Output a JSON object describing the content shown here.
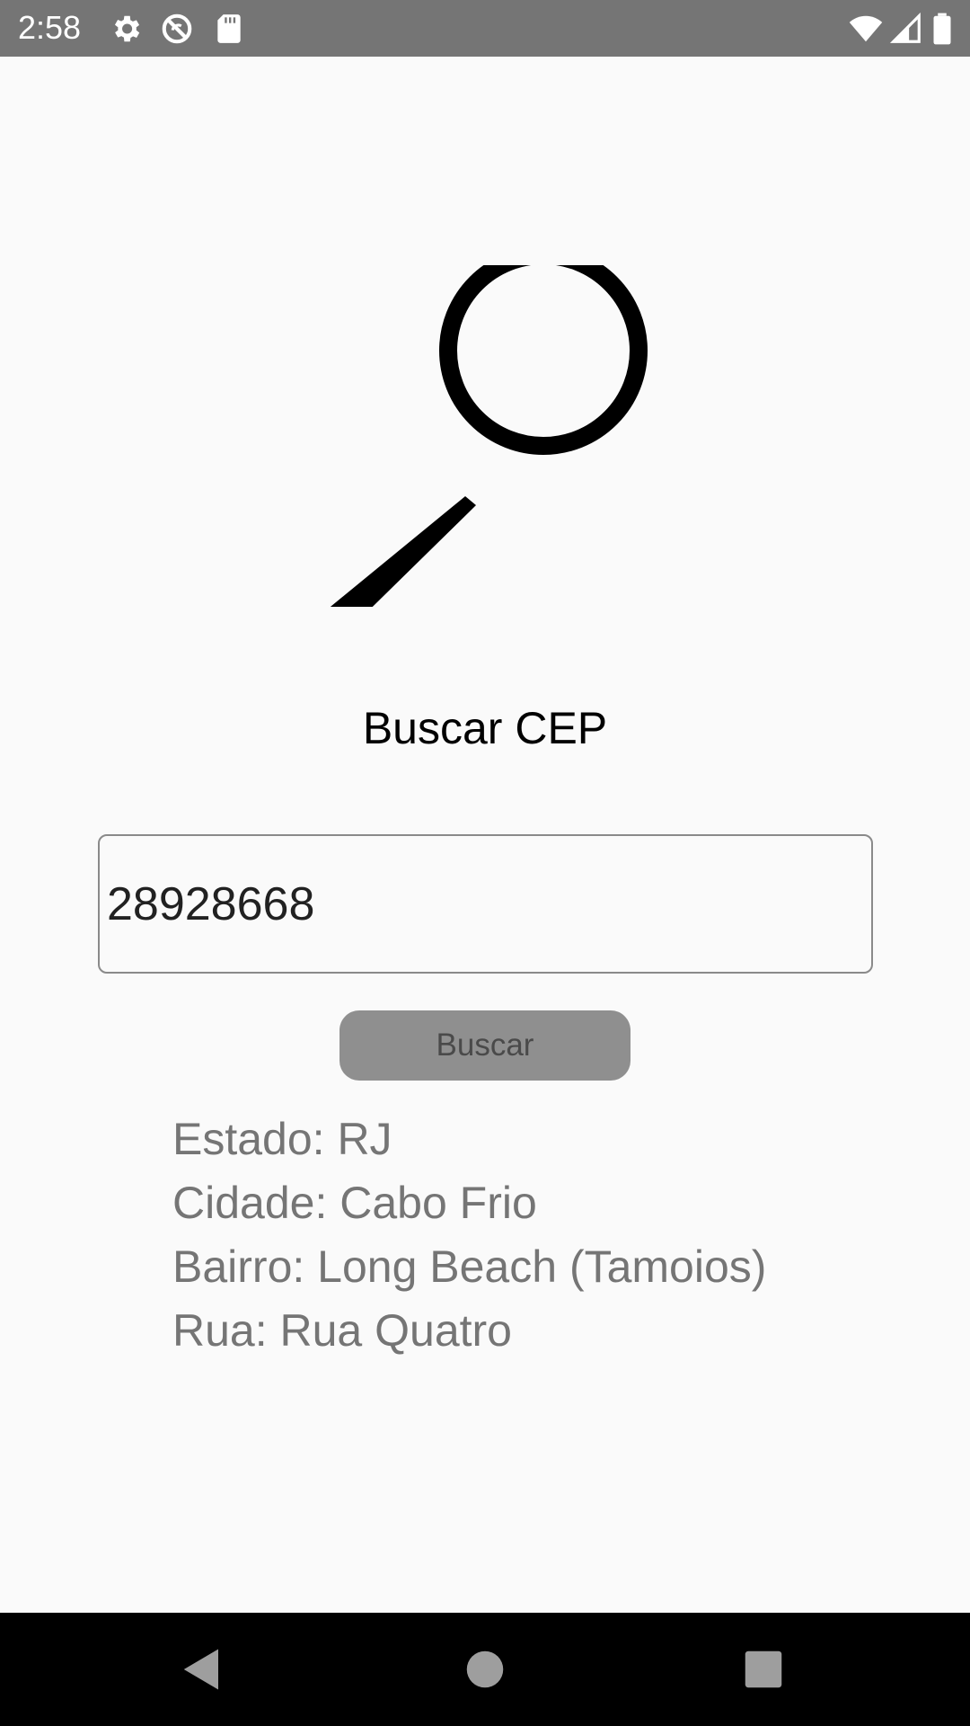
{
  "status_bar": {
    "time": "2:58",
    "left_icons": [
      "gear-icon",
      "no-sync-icon",
      "sd-card-icon"
    ],
    "right_icons": [
      "wifi-icon",
      "signal-icon",
      "battery-icon"
    ]
  },
  "main": {
    "hero_icon": "magnifying-glass-icon",
    "title": "Buscar CEP",
    "cep_input_value": "28928668",
    "search_button_label": "Buscar",
    "results": {
      "estado": "Estado: RJ",
      "cidade": "Cidade: Cabo Frio",
      "bairro": "Bairro: Long Beach (Tamoios)",
      "rua": "Rua: Rua Quatro"
    }
  },
  "nav_bar": {
    "icons": [
      "back-icon",
      "home-icon",
      "recents-icon"
    ]
  },
  "colors": {
    "status_bar": "#757575",
    "background": "#fafafa",
    "button": "#8f8f8f",
    "result_text": "#757575",
    "nav_bar": "#000000"
  }
}
